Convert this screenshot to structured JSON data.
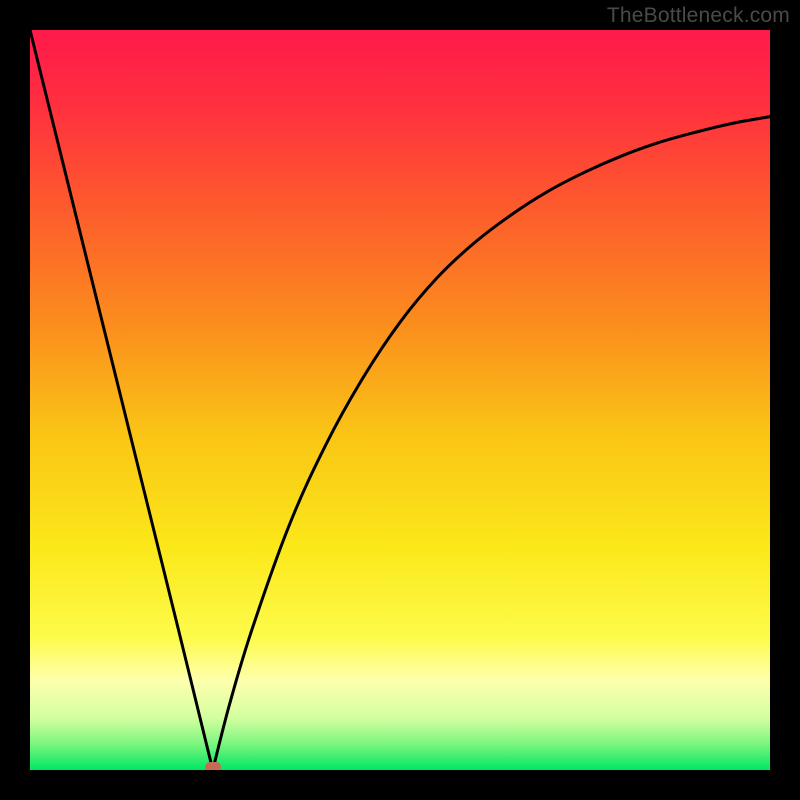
{
  "watermark": "TheBottleneck.com",
  "chart_data": {
    "type": "line",
    "title": "",
    "xlabel": "",
    "ylabel": "",
    "xlim": [
      0,
      100
    ],
    "ylim": [
      0,
      100
    ],
    "grid": false,
    "legend": false,
    "annotations": [],
    "gradient_stops": [
      {
        "pos": 0.0,
        "color": "#ff1a4b"
      },
      {
        "pos": 0.1,
        "color": "#ff2f3f"
      },
      {
        "pos": 0.25,
        "color": "#fd5e2b"
      },
      {
        "pos": 0.4,
        "color": "#fb8e1d"
      },
      {
        "pos": 0.55,
        "color": "#fac615"
      },
      {
        "pos": 0.7,
        "color": "#fbe81a"
      },
      {
        "pos": 0.82,
        "color": "#fdfb4a"
      },
      {
        "pos": 0.88,
        "color": "#feffae"
      },
      {
        "pos": 0.93,
        "color": "#d2ff9f"
      },
      {
        "pos": 0.965,
        "color": "#7cf57e"
      },
      {
        "pos": 1.0,
        "color": "#00e765"
      }
    ],
    "series": [
      {
        "name": "bottleneck-curve",
        "points": [
          {
            "x": 0.0,
            "y": 100.0
          },
          {
            "x": 5.0,
            "y": 79.8
          },
          {
            "x": 10.0,
            "y": 59.6
          },
          {
            "x": 15.0,
            "y": 39.4
          },
          {
            "x": 20.0,
            "y": 19.2
          },
          {
            "x": 24.7,
            "y": 0.0
          },
          {
            "x": 27.0,
            "y": 9.0
          },
          {
            "x": 30.0,
            "y": 19.0
          },
          {
            "x": 35.0,
            "y": 33.0
          },
          {
            "x": 40.0,
            "y": 44.0
          },
          {
            "x": 45.0,
            "y": 53.0
          },
          {
            "x": 50.0,
            "y": 60.5
          },
          {
            "x": 55.0,
            "y": 66.5
          },
          {
            "x": 60.0,
            "y": 71.2
          },
          {
            "x": 65.0,
            "y": 75.0
          },
          {
            "x": 70.0,
            "y": 78.2
          },
          {
            "x": 75.0,
            "y": 80.8
          },
          {
            "x": 80.0,
            "y": 83.0
          },
          {
            "x": 85.0,
            "y": 84.8
          },
          {
            "x": 90.0,
            "y": 86.2
          },
          {
            "x": 95.0,
            "y": 87.4
          },
          {
            "x": 100.0,
            "y": 88.3
          }
        ]
      }
    ],
    "marker": {
      "x": 24.7,
      "y": 0.0,
      "color": "#c76a58"
    },
    "curve_color": "#000000",
    "curve_width": 3.0
  }
}
